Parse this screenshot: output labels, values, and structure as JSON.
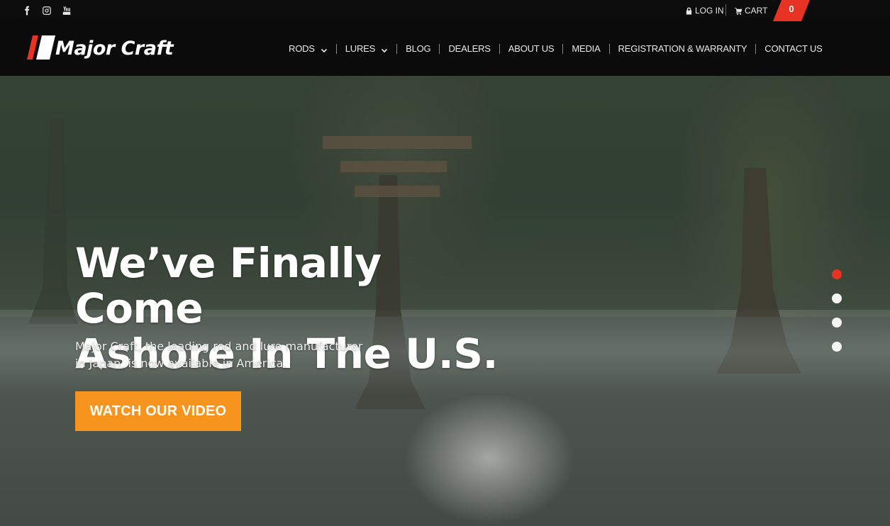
{
  "social": {
    "icons": [
      "facebook-icon",
      "instagram-icon",
      "youtube-icon"
    ]
  },
  "utility": {
    "login_label": "LOG IN",
    "cart_label": "CART",
    "cart_count": "0"
  },
  "header": {
    "logo_text": "Major Craft",
    "nav": [
      {
        "label": "RODS",
        "has_dropdown": true
      },
      {
        "label": "LURES",
        "has_dropdown": true
      },
      {
        "label": "BLOG",
        "has_dropdown": false
      },
      {
        "label": "DEALERS",
        "has_dropdown": false
      },
      {
        "label": "ABOUT US",
        "has_dropdown": false
      },
      {
        "label": "MEDIA",
        "has_dropdown": false
      },
      {
        "label": "REGISTRATION & WARRANTY",
        "has_dropdown": false
      },
      {
        "label": "CONTACT US",
        "has_dropdown": false
      }
    ]
  },
  "hero": {
    "title_line1": "We’ve Finally Come",
    "title_line2": "Ashore In The U.S.",
    "subtitle_line1": "Major Craft, the leading rod and lure manufacturer",
    "subtitle_line2": "in Japan, is now available in America.",
    "cta_label": "WATCH OUR VIDEO",
    "slides_total": 4,
    "active_slide": 1
  },
  "colors": {
    "accent_red": "#e63323",
    "cta_orange": "#f7941d",
    "header_bg": "#0b0b0b"
  }
}
